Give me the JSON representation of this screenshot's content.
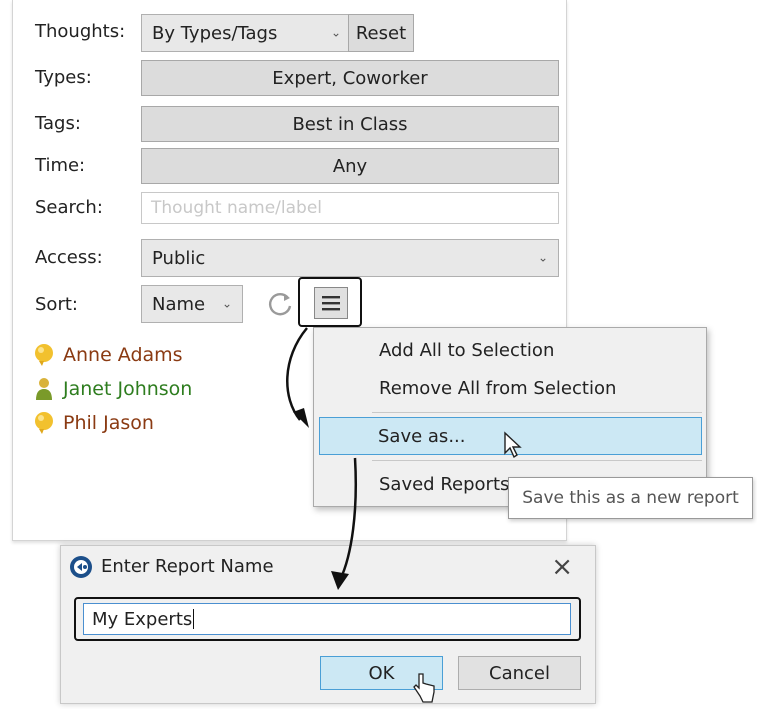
{
  "filters": {
    "thoughts_label": "Thoughts:",
    "thoughts_value": "By Types/Tags",
    "reset_label": "Reset",
    "types_label": "Types:",
    "types_value": "Expert, Coworker",
    "tags_label": "Tags:",
    "tags_value": "Best in Class",
    "time_label": "Time:",
    "time_value": "Any",
    "search_label": "Search:",
    "search_placeholder": "Thought name/label",
    "access_label": "Access:",
    "access_value": "Public",
    "sort_label": "Sort:",
    "sort_value": "Name"
  },
  "people": [
    {
      "name": "Anne Adams",
      "color": "#8a3a12",
      "icon": "person-bubble-icon"
    },
    {
      "name": "Janet Johnson",
      "color": "#2e7d1f",
      "icon": "person-icon"
    },
    {
      "name": "Phil Jason",
      "color": "#8a3a12",
      "icon": "person-bubble-icon"
    }
  ],
  "context_menu": {
    "items": [
      "Add All to Selection",
      "Remove All from Selection",
      "Save as...",
      "Saved Reports"
    ],
    "highlighted": "Save as..."
  },
  "tooltip": "Save this as a new report",
  "dialog": {
    "title": "Enter Report Name",
    "input_value": "My Experts",
    "ok_label": "OK",
    "cancel_label": "Cancel"
  },
  "colors": {
    "highlight_fill": "#cce8f4",
    "highlight_border": "#4a9fd6",
    "callout_border": "#111111"
  }
}
